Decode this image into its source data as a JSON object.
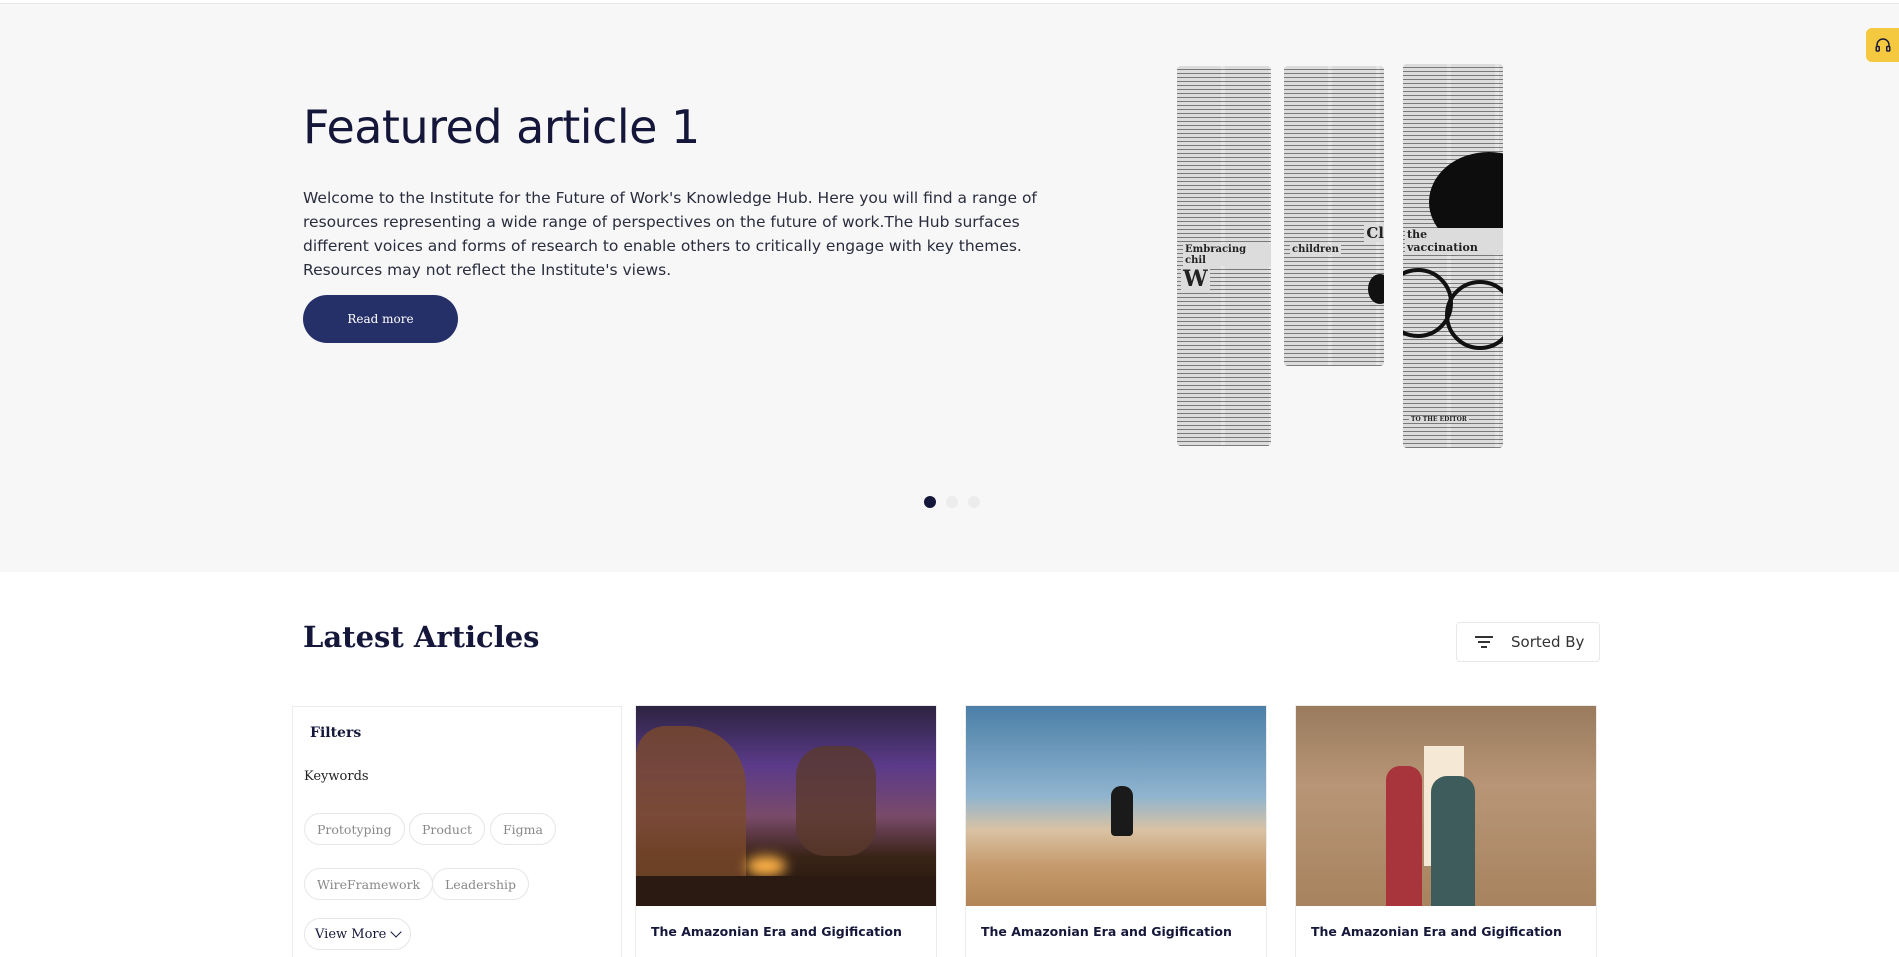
{
  "hero": {
    "title": "Featured article 1",
    "description": "Welcome to the Institute for the Future of Work's Knowledge Hub. Here you will find a range of resources representing a wide range of perspectives on the future of work.The Hub surfaces different voices and forms of research to enable others to critically engage with key themes. Resources may not reflect the Institute's views.",
    "read_more_label": "Read more",
    "carousel": {
      "slides": 3,
      "active_index": 0
    },
    "image_text": {
      "headline_1": "Embracing chil",
      "headline_2": "children",
      "headline_3": "the vaccination",
      "headline_4": "Clo",
      "headline_5": "TO THE EDITOR"
    }
  },
  "latest": {
    "title": "Latest Articles",
    "sort_label": "Sorted By",
    "sort_icon": "filter-lines-icon"
  },
  "filters": {
    "title": "Filters",
    "keywords_label": "Keywords",
    "chips": [
      "Prototyping",
      "Product",
      "Figma",
      "WireFramework",
      "Leadership"
    ],
    "view_more_label": "View More"
  },
  "articles": [
    {
      "title": "The Amazonian Era and Gigification"
    },
    {
      "title": "The Amazonian Era and Gigification"
    },
    {
      "title": "The Amazonian Era and Gigification"
    }
  ],
  "support": {
    "icon": "headset-icon"
  },
  "colors": {
    "accent": "#263068",
    "title": "#15173a",
    "hero_bg": "#f7f7f7",
    "support": "#f5c93f"
  }
}
